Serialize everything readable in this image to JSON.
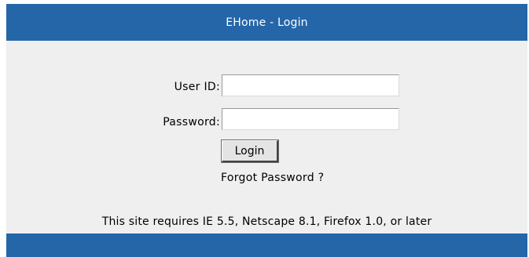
{
  "header": {
    "title": "EHome - Login"
  },
  "form": {
    "userid_label": "User ID:",
    "userid_value": "",
    "password_label": "Password:",
    "password_value": "",
    "login_button": "Login",
    "forgot_link": "Forgot Password ?"
  },
  "footer": {
    "requirements": "This site requires IE 5.5, Netscape 8.1, Firefox 1.0, or later"
  },
  "colors": {
    "bar": "#2466a8",
    "panel": "#efefef",
    "header_text": "#ffffff"
  }
}
